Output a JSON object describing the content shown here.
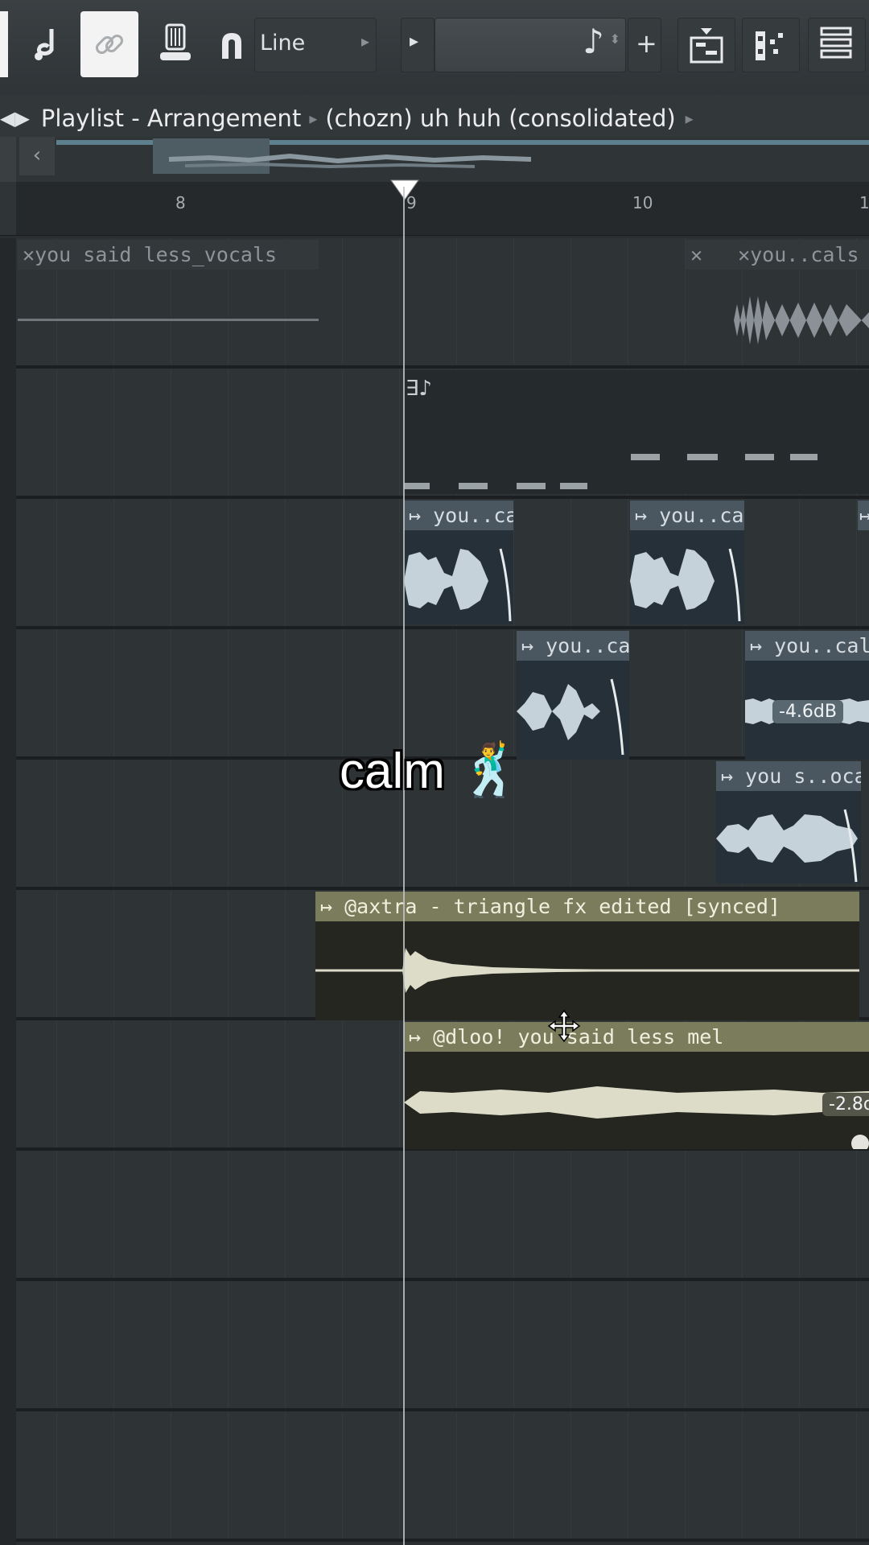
{
  "toolbar": {
    "snap_mode": "Line",
    "note_symbol": "♪",
    "add_symbol": "+"
  },
  "breadcrumb": {
    "window": "Playlist - Arrangement",
    "pattern": "(chozn) uh huh (consolidated)"
  },
  "ruler": {
    "ticks": [
      "8",
      "9",
      "10",
      "1"
    ]
  },
  "clips": {
    "row1_left": "you said less_vocals",
    "row1_right": "you..cals",
    "row3_a": "you..cals",
    "row3_b": "you..cals",
    "row4_a": "you..cals",
    "row4_b": "you..cals",
    "row4_gain": "-4.6dB",
    "row5_a": "you s..ocals",
    "row6": "@axtra - triangle fx edited [synced]",
    "row7": "@dloo! you said less mel",
    "row7_gain": "-2.8d"
  },
  "overlay": {
    "caption": "calm",
    "emoji": "🕺"
  },
  "colors": {
    "accent_blue": "#4a5761",
    "accent_olive": "#7b7c5c",
    "background": "#2a2e31"
  }
}
